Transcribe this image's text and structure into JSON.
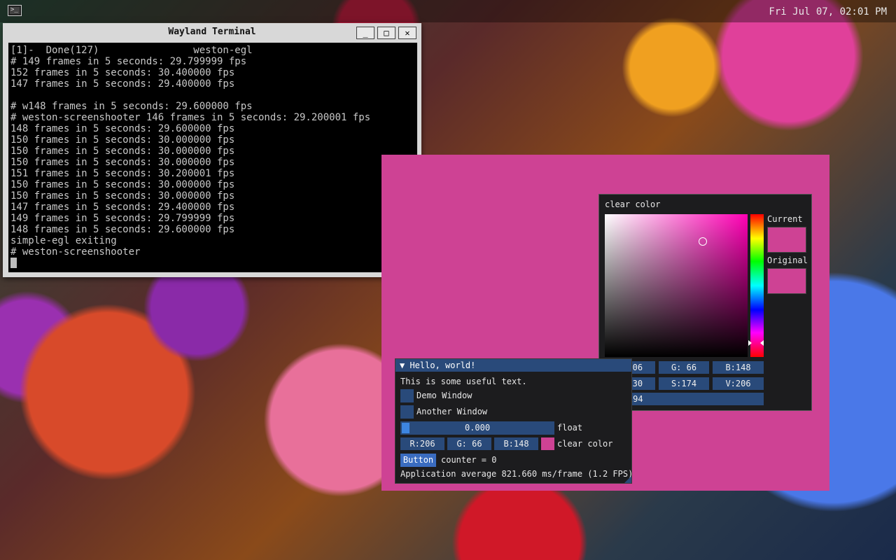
{
  "panel": {
    "launcher_icon": "terminal-icon",
    "clock": "Fri Jul 07, 02:01 PM"
  },
  "terminal": {
    "title": "Wayland Terminal",
    "buttons": {
      "minimize": "_",
      "maximize": "□",
      "close": "✕"
    },
    "lines": [
      "[1]-  Done(127)                weston-egl",
      "# 149 frames in 5 seconds: 29.799999 fps",
      "152 frames in 5 seconds: 30.400000 fps",
      "147 frames in 5 seconds: 29.400000 fps",
      "",
      "# w148 frames in 5 seconds: 29.600000 fps",
      "# weston-screenshooter 146 frames in 5 seconds: 29.200001 fps",
      "148 frames in 5 seconds: 29.600000 fps",
      "150 frames in 5 seconds: 30.000000 fps",
      "150 frames in 5 seconds: 30.000000 fps",
      "150 frames in 5 seconds: 30.000000 fps",
      "151 frames in 5 seconds: 30.200001 fps",
      "150 frames in 5 seconds: 30.000000 fps",
      "150 frames in 5 seconds: 30.000000 fps",
      "147 frames in 5 seconds: 29.400000 fps",
      "149 frames in 5 seconds: 29.799999 fps",
      "148 frames in 5 seconds: 29.600000 fps",
      "simple-egl exiting",
      "# weston-screenshooter"
    ]
  },
  "app": {
    "background": "#ce4294"
  },
  "picker": {
    "title": "clear color",
    "current_label": "Current",
    "original_label": "Original",
    "rgb": [
      "R:206",
      "G: 66",
      "B:148"
    ],
    "hsv": [
      "H:230",
      "S:174",
      "V:206"
    ],
    "hex": "#CE4294"
  },
  "hello": {
    "title": "▼ Hello, world!",
    "text": "This is some useful text.",
    "demo_window": "Demo Window",
    "another_window": "Another Window",
    "slider_value": "0.000",
    "slider_label": "float",
    "slider_fraction": 0.0,
    "rgb": [
      "R:206",
      "G: 66",
      "B:148"
    ],
    "color_label": "clear color",
    "button_label": "Button",
    "counter": "counter = 0",
    "fps": "Application average 821.660 ms/frame (1.2 FPS)"
  }
}
